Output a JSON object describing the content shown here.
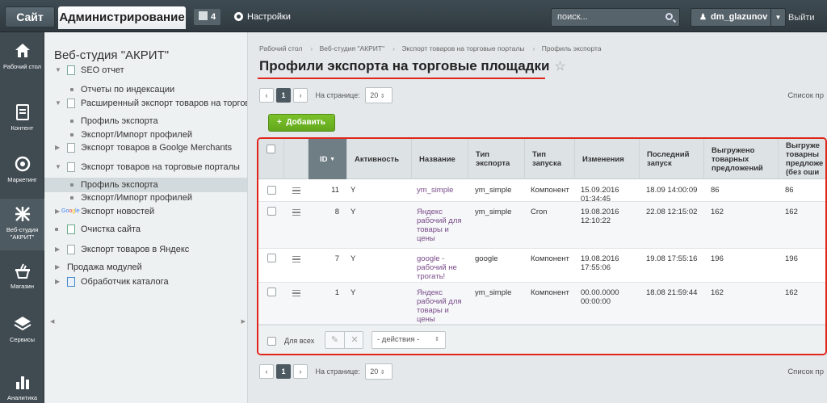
{
  "topbar": {
    "site_label": "Сайт",
    "admin_label": "Администрирование",
    "notif_count": "4",
    "settings_label": "Настройки",
    "search_placeholder": "поиск...",
    "user_name": "dm_glazunov",
    "logout_label": "Выйти"
  },
  "leftnav": {
    "items": [
      {
        "label": "Рабочий стол",
        "icon": "home-icon"
      },
      {
        "label": "Контент",
        "icon": "document-icon"
      },
      {
        "label": "Маркетинг",
        "icon": "target-icon"
      },
      {
        "label": "Веб-студия \"АКРИТ\"",
        "icon": "akrit-logo-icon"
      },
      {
        "label": "Магазин",
        "icon": "cart-icon"
      },
      {
        "label": "Сервисы",
        "icon": "layers-icon"
      },
      {
        "label": "Аналитика",
        "icon": "chart-icon"
      }
    ]
  },
  "tree": {
    "title": "Веб-студия \"АКРИТ\"",
    "items": [
      {
        "label": "SEO отчет"
      },
      {
        "label": "Отчеты по индексации"
      },
      {
        "label": "Расширенный экспорт товаров на торговые п"
      },
      {
        "label": "Профиль экспорта"
      },
      {
        "label": "Экспорт/Импорт профилей"
      },
      {
        "label": "Экспорт товаров в Goolge Merchants"
      },
      {
        "label": "Экспорт товаров на торговые порталы"
      },
      {
        "label": "Профиль экспорта"
      },
      {
        "label": "Экспорт/Импорт профилей"
      },
      {
        "label": "Экспорт новостей"
      },
      {
        "label": "Очистка сайта"
      },
      {
        "label": "Экспорт товаров в Яндекс"
      },
      {
        "label": "Продажа модулей"
      },
      {
        "label": "Обработчик каталога"
      }
    ]
  },
  "breadcrumbs": [
    "Рабочий стол",
    "Веб-студия \"АКРИТ\"",
    "Экспорт товаров на торговые порталы",
    "Профиль экспорта"
  ],
  "page_title": "Профили экспорта на торговые площадки",
  "pager": {
    "prev": "‹",
    "next": "›",
    "page": "1",
    "per_page_label": "На странице:",
    "per_page_value": "20",
    "list_label": "Список пр"
  },
  "add_button": "Добавить",
  "table": {
    "columns": {
      "id": "ID",
      "active": "Активность",
      "name": "Название",
      "export_type": "Тип экспорта",
      "run_type": "Тип запуска",
      "changed": "Изменения",
      "last_run": "Последний запуск",
      "exported": "Выгружено товарных предложений",
      "exported_ok": "Выгруже товарны предложе (без оши"
    },
    "rows": [
      {
        "id": "11",
        "active": "Y",
        "name": "ym_simple",
        "export_type": "ym_simple",
        "run_type": "Компонент",
        "changed": "15.09.2016 01:34:45",
        "last_run": "18.09 14:00:09",
        "exported": "86",
        "exported_ok": "86"
      },
      {
        "id": "8",
        "active": "Y",
        "name": "Яндекс рабочий для товары и цены",
        "export_type": "ym_simple",
        "run_type": "Cron",
        "changed": "19.08.2016 12:10:22",
        "last_run": "22.08 12:15:02",
        "exported": "162",
        "exported_ok": "162"
      },
      {
        "id": "7",
        "active": "Y",
        "name": "google - рабочий не трогать!",
        "export_type": "google",
        "run_type": "Компонент",
        "changed": "19.08.2016 17:55:06",
        "last_run": "19.08 17:55:16",
        "exported": "196",
        "exported_ok": "196"
      },
      {
        "id": "1",
        "active": "Y",
        "name": "Яндекс рабочий для товары и цены",
        "export_type": "ym_simple",
        "run_type": "Компонент",
        "changed": "00.00.0000 00:00:00",
        "last_run": "18.08 21:59:44",
        "exported": "162",
        "exported_ok": "162"
      }
    ],
    "footer": {
      "for_all": "Для всех",
      "actions": "- действия -"
    }
  }
}
